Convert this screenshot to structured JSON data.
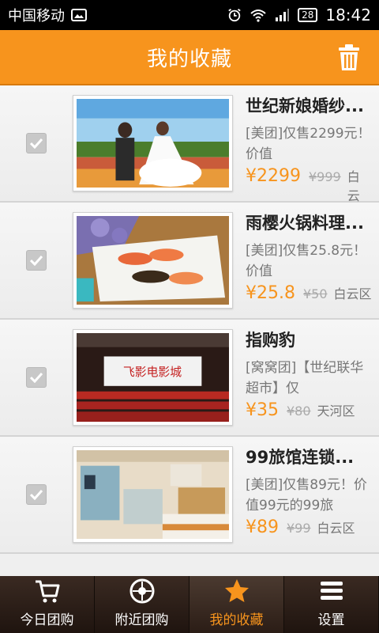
{
  "status_bar": {
    "carrier": "中国移动",
    "battery": "28",
    "time": "18:42"
  },
  "header": {
    "title": "我的收藏"
  },
  "items": [
    {
      "title": "世纪新娘婚纱...",
      "desc": "[美团]仅售2299元！价值",
      "price": "¥2299",
      "orig": "¥999",
      "area": "白云区"
    },
    {
      "title": "雨樱火锅料理...",
      "desc": "[美团]仅售25.8元！价值",
      "price": "¥25.8",
      "orig": "¥50",
      "area": "白云区"
    },
    {
      "title": "指购豹",
      "desc": "[窝窝团]【世纪联华超市】仅",
      "price": "¥35",
      "orig": "¥80",
      "area": "天河区"
    },
    {
      "title": "99旅馆连锁...",
      "desc": "[美团]仅售89元！价值99元的99旅",
      "price": "¥89",
      "orig": "¥99",
      "area": "白云区"
    }
  ],
  "cinema_sign": "飞影电影城",
  "tabs": [
    {
      "label": "今日团购",
      "icon": "cart-icon"
    },
    {
      "label": "附近团购",
      "icon": "location-icon"
    },
    {
      "label": "我的收藏",
      "icon": "star-icon"
    },
    {
      "label": "设置",
      "icon": "settings-icon"
    }
  ],
  "colors": {
    "accent": "#f7941d",
    "tabbar": "#2b1d16"
  }
}
